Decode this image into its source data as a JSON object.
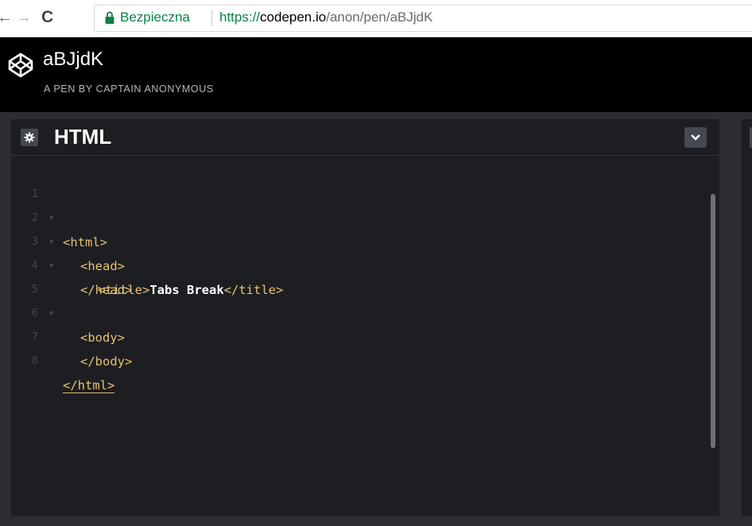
{
  "browser": {
    "secure_label": "Bezpieczna",
    "url_scheme": "https://",
    "url_host": "codepen.io",
    "url_path": "/anon/pen/aBJjdK",
    "back_icon": "arrow-left-icon",
    "forward_icon": "arrow-right-icon",
    "reload_icon": "reload-icon",
    "lock_icon": "lock-icon",
    "secure_color": "#0b8043"
  },
  "pen": {
    "title": "aBJjdK",
    "subtitle": "A PEN BY CAPTAIN ANONYMOUS",
    "logo_icon": "codepen-logo-icon"
  },
  "editor": {
    "title": "HTML",
    "settings_icon": "gear-icon",
    "collapse_icon": "chevron-down-icon",
    "lines": [
      {
        "num": "1",
        "fold": true
      },
      {
        "num": "2",
        "fold": true
      },
      {
        "num": "3",
        "fold": true
      },
      {
        "num": "4",
        "fold": false
      },
      {
        "num": "5",
        "fold": true
      },
      {
        "num": "6",
        "fold": false
      },
      {
        "num": "7",
        "fold": false
      },
      {
        "num": "8",
        "fold": false
      }
    ],
    "code": {
      "l1_open": "<html>",
      "l2_open": "<head>",
      "l3_open": "<title>",
      "l3_text": "Tabs Break",
      "l3_close": "</title>",
      "l4_close": "</head>",
      "l5_open": "<body>",
      "l7_close": "</body>",
      "l8_close": "</html>"
    },
    "tag_color": "#e6c16f"
  }
}
